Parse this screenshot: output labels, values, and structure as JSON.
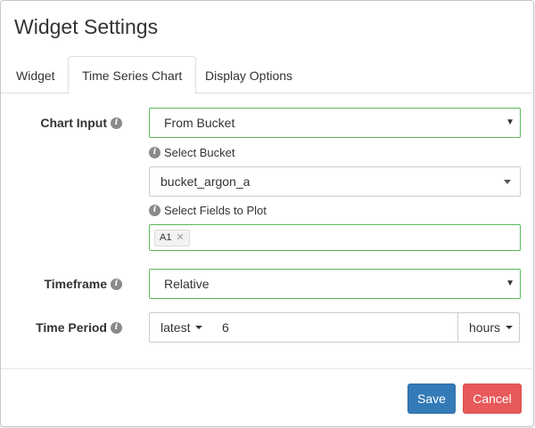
{
  "modal": {
    "title": "Widget Settings"
  },
  "tabs": [
    {
      "label": "Widget"
    },
    {
      "label": "Time Series Chart",
      "active": true
    },
    {
      "label": "Display Options"
    }
  ],
  "form": {
    "chart_input": {
      "label": "Chart Input",
      "value": "From Bucket"
    },
    "select_bucket": {
      "label": "Select Bucket",
      "value": "bucket_argon_a"
    },
    "select_fields": {
      "label": "Select Fields to Plot",
      "tags": [
        "A1"
      ]
    },
    "timeframe": {
      "label": "Timeframe",
      "value": "Relative"
    },
    "time_period": {
      "label": "Time Period",
      "mode": "latest",
      "value": "6",
      "unit": "hours"
    }
  },
  "footer": {
    "save_label": "Save",
    "cancel_label": "Cancel"
  },
  "colors": {
    "primary": "#337ab7",
    "danger": "#e8595a",
    "valid_border": "#5cb85c"
  }
}
